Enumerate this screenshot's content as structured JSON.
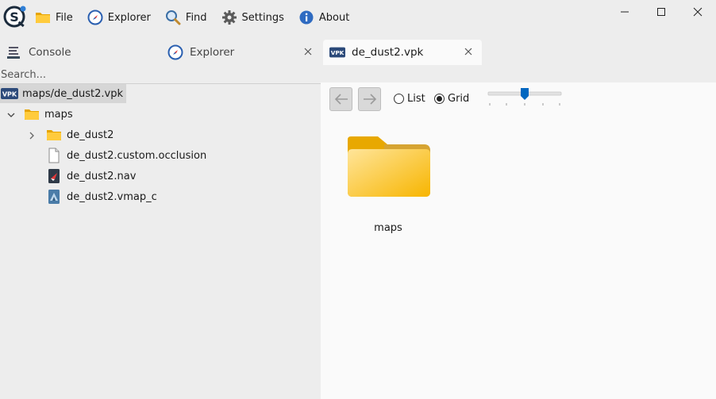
{
  "menu": {
    "items": [
      {
        "label": "File",
        "icon": "folder-icon"
      },
      {
        "label": "Explorer",
        "icon": "compass-icon"
      },
      {
        "label": "Find",
        "icon": "magnifier-icon"
      },
      {
        "label": "Settings",
        "icon": "gear-icon"
      },
      {
        "label": "About",
        "icon": "info-icon"
      }
    ]
  },
  "tabs": [
    {
      "label": "Console",
      "icon": "console-icon",
      "closable": false
    },
    {
      "label": "Explorer",
      "icon": "compass-icon",
      "closable": true
    },
    {
      "label": "de_dust2.vpk",
      "icon": "vpk-icon",
      "closable": true,
      "active": true
    }
  ],
  "left": {
    "search_placeholder": "Search...",
    "root": {
      "label": "maps/de_dust2.vpk",
      "icon_text": "VPK"
    },
    "tree": [
      {
        "label": "maps",
        "icon": "folder-icon",
        "expanded": true,
        "depth": 1
      },
      {
        "label": "de_dust2",
        "icon": "folder-icon",
        "expanded": false,
        "depth": 2
      },
      {
        "label": "de_dust2.custom.occlusion",
        "icon": "file-icon",
        "depth": 2
      },
      {
        "label": "de_dust2.nav",
        "icon": "nav-file-icon",
        "depth": 2
      },
      {
        "label": "de_dust2.vmap_c",
        "icon": "vmap-file-icon",
        "depth": 2
      }
    ]
  },
  "right": {
    "view_options": [
      {
        "label": "List",
        "selected": false
      },
      {
        "label": "Grid",
        "selected": true
      }
    ],
    "zoom_level": 0.5,
    "items": [
      {
        "label": "maps",
        "icon": "folder-icon"
      }
    ]
  },
  "colors": {
    "folder": "#f7b500",
    "accent": "#0067c0",
    "vpk_badge": "#2c4a7a"
  }
}
